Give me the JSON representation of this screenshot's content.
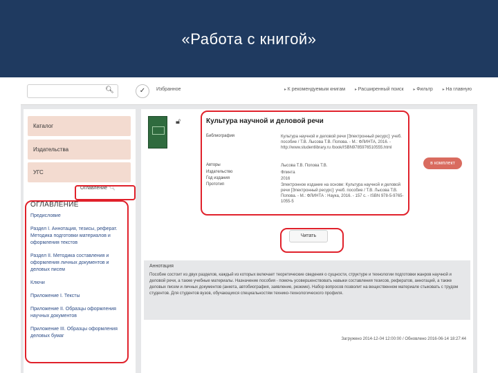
{
  "slide": {
    "title": "«Работа с книгой»"
  },
  "topbar": {
    "search_placeholder": "",
    "favorites_label": "Избранное",
    "nav": [
      "К рекомендуемым книгам",
      "Расширенный поиск",
      "Фильтр",
      "На главную"
    ]
  },
  "sidebar": {
    "buttons": [
      "Каталог",
      "Издательства",
      "УГС"
    ],
    "toc_search_label": "Оглавление",
    "toc_heading": "ОГЛАВЛЕНИЕ",
    "toc_items": [
      "Предисловие",
      "Раздел I. Аннотация, тезисы, реферат. Методика подготовки материалов и оформления текстов",
      "Раздел II. Методика составления и оформления личных документов и деловых писем",
      "Ключи",
      "Приложение I. Тексты",
      "Приложение II. Образцы оформления научных документов",
      "Приложение III. Образцы оформления деловых бумаг"
    ]
  },
  "book": {
    "title": "Культура научной и деловой речи",
    "meta": [
      {
        "label": "Библиография",
        "value": "Культура научной и деловой речи [Электронный ресурс]: учеб. пособие / Т.В. Лысова Т.В. Попова. - М.: ФЛИНТА, 2016. - http://www.studentlibrary.ru /book/ISBN9785976510555.html"
      },
      {
        "label": "Авторы",
        "value": "Лысова Т.В. Попова Т.В."
      },
      {
        "label": "Издательство",
        "value": "Флинта"
      },
      {
        "label": "Год издания",
        "value": "2016"
      },
      {
        "label": "Прототип",
        "value": "Электронное издание на основе: Культура научной и деловой речи [Электронный ресурс]: учеб. пособие / Т.В. Лысова Т.В. Попова. - М.: ФЛИНТА : Наука, 2016. - 157 с. - ISBN 978-5-9765-1055-5"
      }
    ],
    "add_label": "в комплект",
    "read_label": "Читать"
  },
  "annotation": {
    "title": "Аннотация",
    "text": "Пособие состоит из двух разделов, каждый из которых включает теоретические сведения о сущности, структуре и технологии подготовки жанров научной и деловой речи, а также учебные материалы. Назначение пособия - помочь усовершенствовать навыки составления тезисов, рефератов, аннотаций, а также деловых писем и личных документов (анкета, автобиография, заявление, резюме). Набор вопросов позволит на вещественном материале стыковать с трудом студентов. Для студентов вузов, обучающихся специальностям технико-технологического профиля."
  },
  "footer": {
    "text": "Загружено 2014-12-04 12:00:00 / Обновлено 2016-06-14 18:27:44"
  },
  "colors": {
    "header": "#1f3a60",
    "highlight": "#e0202a",
    "sidebar_button": "#f3dbd0",
    "add_button": "#d96b5f"
  }
}
